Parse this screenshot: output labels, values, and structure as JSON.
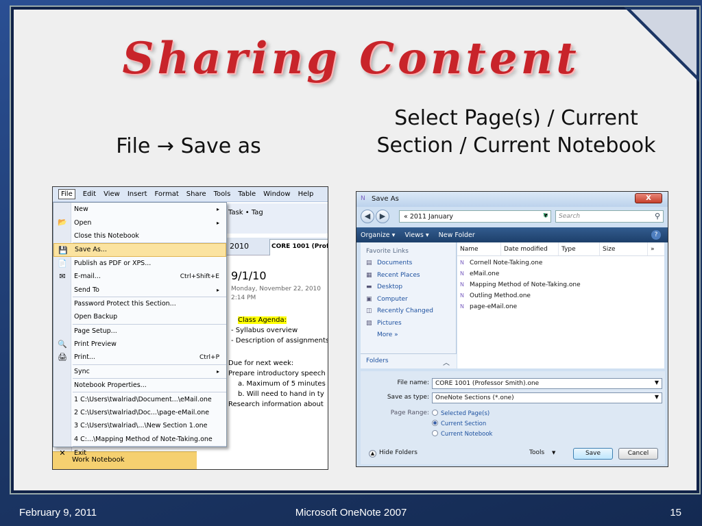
{
  "slide": {
    "title": "Sharing Content",
    "left_label": "File → Save as",
    "right_label_line1": "Select Page(s) / Current",
    "right_label_line2": "Section / Current Notebook"
  },
  "onenote": {
    "menubar": [
      "File",
      "Edit",
      "View",
      "Insert",
      "Format",
      "Share",
      "Tools",
      "Table",
      "Window",
      "Help"
    ],
    "toolbar_text": "Task • Tag",
    "tab_2010": "2010",
    "tab_core": "CORE 1001 (Prof.",
    "page_date": "9/1/10",
    "page_meta_1": "Monday, November 22, 2010",
    "page_meta_2": "2:14 PM",
    "body_agenda": "Class Agenda:",
    "body_l1": "-   Syllabus overview",
    "body_l2": "-   Description of assignments",
    "body_l3": "Due for next week:",
    "body_l4": "Prepare introductory speech",
    "body_l5": "a.    Maximum of 5 minutes",
    "body_l6": "b.    Will need to hand in ty",
    "body_l7": "Research information about",
    "notebook_bottom": "Work Notebook",
    "file_menu": [
      {
        "label": "New",
        "shortcut": "",
        "arrow": "▸",
        "icon": ""
      },
      {
        "label": "Open",
        "shortcut": "",
        "arrow": "▸",
        "icon": "📂"
      },
      {
        "label": "Close this Notebook",
        "shortcut": "",
        "arrow": "",
        "icon": ""
      },
      {
        "label": "Save As...",
        "shortcut": "",
        "arrow": "",
        "icon": "💾"
      },
      {
        "label": "Publish as PDF or XPS...",
        "shortcut": "",
        "arrow": "",
        "icon": "📄"
      },
      {
        "label": "E-mail...",
        "shortcut": "Ctrl+Shift+E",
        "arrow": "",
        "icon": "✉"
      },
      {
        "label": "Send To",
        "shortcut": "",
        "arrow": "▸",
        "icon": ""
      },
      {
        "label": "Password Protect this Section...",
        "shortcut": "",
        "arrow": "",
        "icon": ""
      },
      {
        "label": "Open Backup",
        "shortcut": "",
        "arrow": "",
        "icon": ""
      },
      {
        "label": "Page Setup...",
        "shortcut": "",
        "arrow": "",
        "icon": ""
      },
      {
        "label": "Print Preview",
        "shortcut": "",
        "arrow": "",
        "icon": "🔍"
      },
      {
        "label": "Print...",
        "shortcut": "Ctrl+P",
        "arrow": "",
        "icon": "🖨"
      },
      {
        "label": "Sync",
        "shortcut": "",
        "arrow": "▸",
        "icon": ""
      },
      {
        "label": "Notebook Properties...",
        "shortcut": "",
        "arrow": "",
        "icon": ""
      },
      {
        "label": "1 C:\\Users\\twalriad\\Document...\\eMail.one",
        "shortcut": "",
        "arrow": "",
        "icon": ""
      },
      {
        "label": "2 C:\\Users\\twalriad\\Doc...\\page-eMail.one",
        "shortcut": "",
        "arrow": "",
        "icon": ""
      },
      {
        "label": "3 C:\\Users\\twalriad\\...\\New Section 1.one",
        "shortcut": "",
        "arrow": "",
        "icon": ""
      },
      {
        "label": "4 C:...\\Mapping Method of Note-Taking.one",
        "shortcut": "",
        "arrow": "",
        "icon": ""
      },
      {
        "label": "Exit",
        "shortcut": "",
        "arrow": "",
        "icon": "✕"
      }
    ]
  },
  "save_dialog": {
    "title": "Save As",
    "close": "X",
    "address": "«  2011 January",
    "search_placeholder": "Search",
    "organize": "Organize ▾",
    "views": "Views ▾",
    "new_folder": "New Folder",
    "favorite_links": "Favorite Links",
    "nav_items": [
      "Documents",
      "Recent Places",
      "Desktop",
      "Computer",
      "Recently Changed",
      "Pictures",
      "More »"
    ],
    "folders": "Folders",
    "columns": [
      "Name",
      "Date modified",
      "Type",
      "Size"
    ],
    "files": [
      "Cornell Note-Taking.one",
      "eMail.one",
      "Mapping Method of Note-Taking.one",
      "Outling Method.one",
      "page-eMail.one"
    ],
    "file_name_label": "File name:",
    "file_name_value": "CORE 1001 (Professor Smith).one",
    "save_type_label": "Save as type:",
    "save_type_value": "OneNote Sections (*.one)",
    "page_range_label": "Page Range:",
    "range_options": [
      "Selected Page(s)",
      "Current Section",
      "Current Notebook"
    ],
    "hide_folders": "Hide Folders",
    "tools": "Tools",
    "save": "Save",
    "cancel": "Cancel"
  },
  "footer": {
    "date": "February 9, 2011",
    "center": "Microsoft OneNote 2007",
    "page": "15"
  },
  "colors": {
    "title_red": "#c8242a",
    "frame_blue": "#1b3564",
    "highlight": "#fbe3a0"
  }
}
